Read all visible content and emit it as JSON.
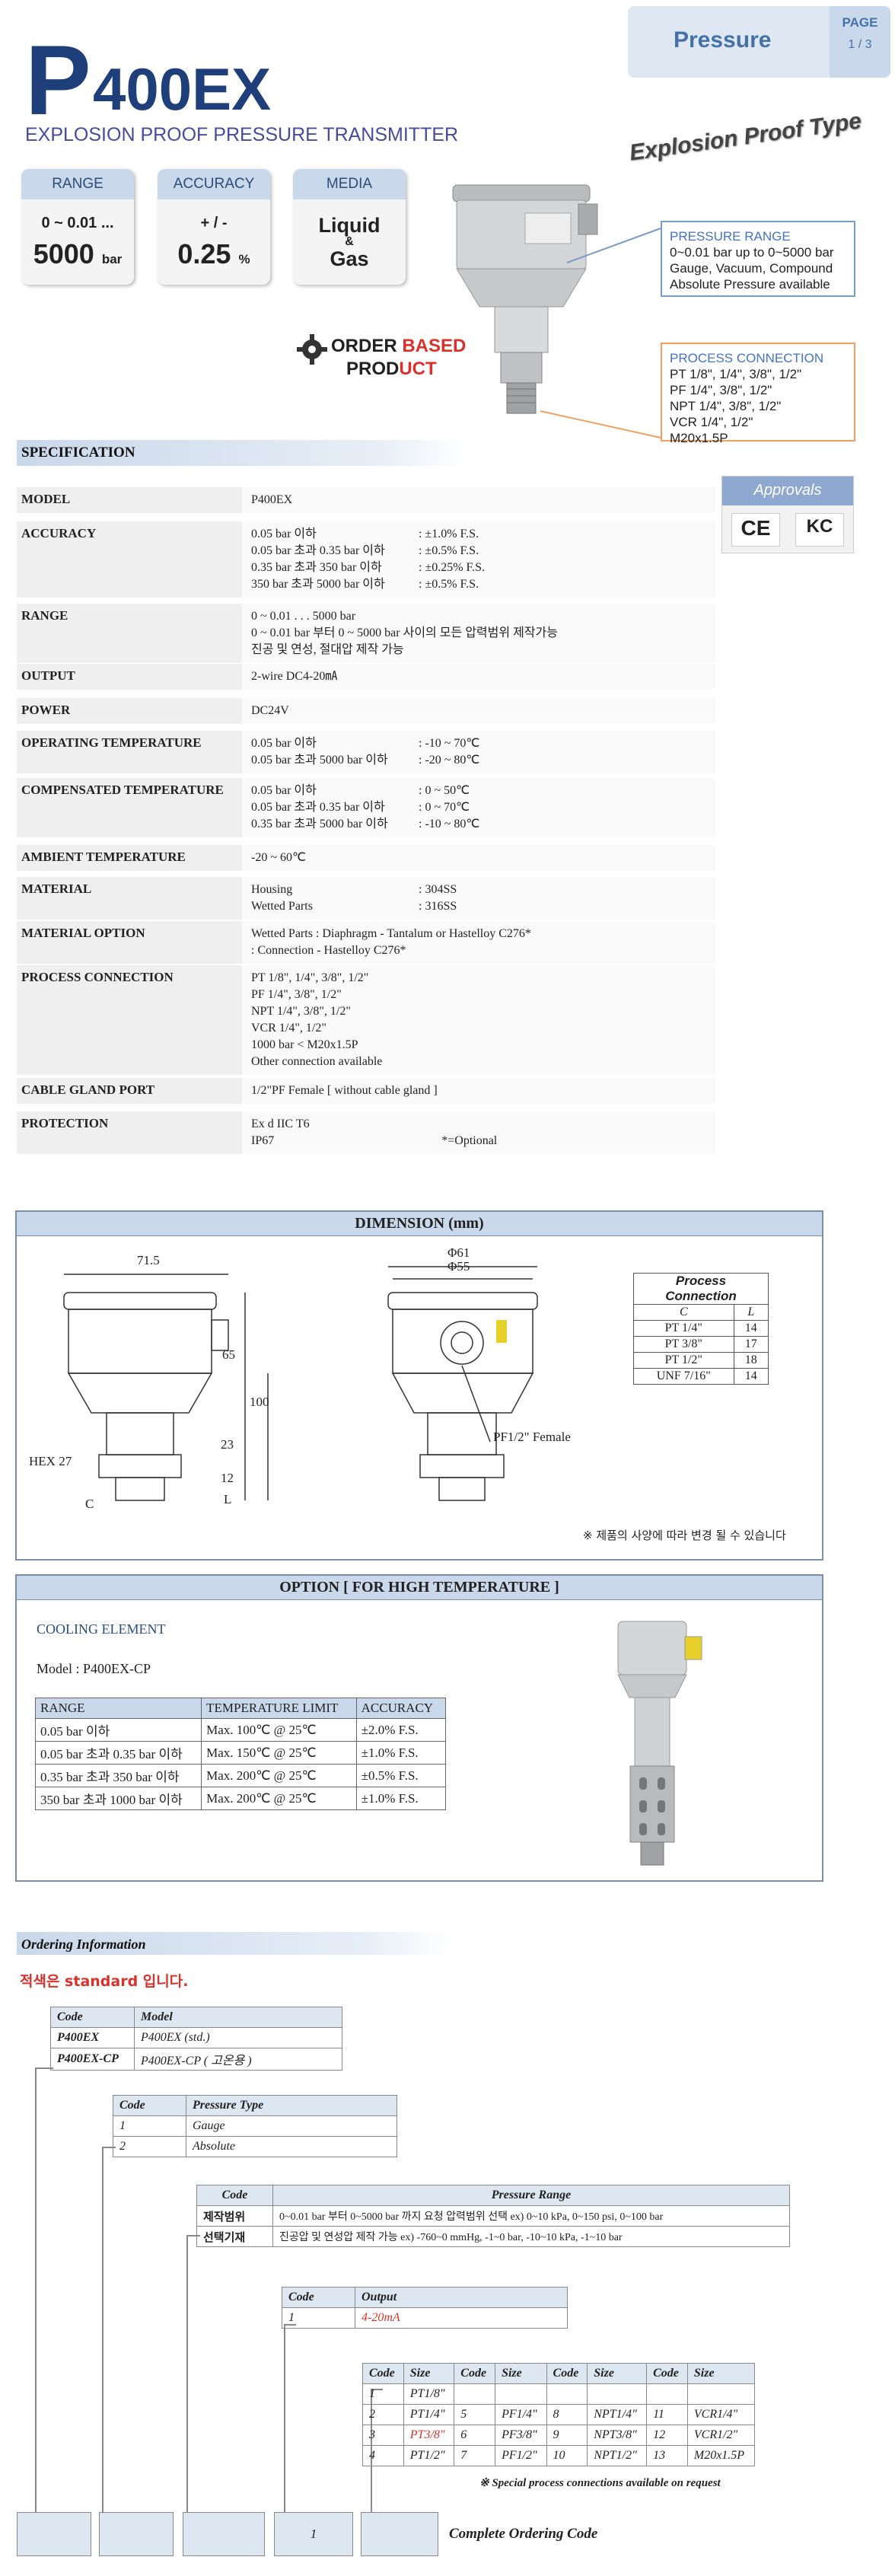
{
  "header": {
    "tab_label": "Pressure",
    "page_label": "PAGE",
    "page_number": "1 / 3",
    "model_big_p": "P",
    "model_rest": "400EX",
    "subtitle": "EXPLOSION PROOF PRESSURE TRANSMITTER",
    "explosion_proof_type": "Explosion Proof Type"
  },
  "badges": [
    {
      "head": "RANGE",
      "line1": "0 ~ 0.01 ...",
      "big": "5000",
      "unit": "bar"
    },
    {
      "head": "ACCURACY",
      "line1": "+ / -",
      "big": "0.25",
      "unit": "%"
    },
    {
      "head": "MEDIA",
      "line1": "Liquid",
      "amp": "&",
      "line2": "Gas"
    }
  ],
  "callouts": {
    "pressure_range": {
      "title": "PRESSURE RANGE",
      "lines": [
        "0~0.01 bar up to 0~5000 bar",
        "Gauge, Vacuum, Compound",
        "Absolute Pressure available"
      ]
    },
    "process_connection": {
      "title": "PROCESS CONNECTION",
      "lines": [
        "PT 1/8\", 1/4\", 3/8\", 1/2\"",
        "PF 1/4\", 3/8\", 1/2\"",
        "NPT 1/4\", 3/8\", 1/2\"",
        "VCR 1/4\", 1/2\"",
        "M20x1.5P"
      ]
    }
  },
  "order_based": {
    "line1a": "ORDER ",
    "line1b": "BASED",
    "line2a": "PROD",
    "line2b": "UCT"
  },
  "specification": {
    "title": "SPECIFICATION",
    "approvals_title": "Approvals",
    "approvals_marks": [
      "CE",
      "KC"
    ],
    "rows": [
      {
        "key": "MODEL",
        "lines": [
          [
            "P400EX",
            ""
          ]
        ]
      },
      {
        "key": "ACCURACY",
        "lines": [
          [
            "0.05 bar 이하",
            ": ±1.0% F.S."
          ],
          [
            "0.05 bar 초과 0.35 bar 이하",
            ": ±0.5% F.S."
          ],
          [
            "0.35 bar 초과 350 bar 이하",
            ": ±0.25% F.S."
          ],
          [
            "350 bar 초과 5000 bar 이하",
            ": ±0.5% F.S."
          ]
        ]
      },
      {
        "key": "RANGE",
        "lines": [
          [
            "0 ~ 0.01 . . . 5000 bar",
            ""
          ],
          [
            "0 ~ 0.01 bar 부터 0 ~ 5000 bar 사이의 모든 압력범위 제작가능",
            ""
          ],
          [
            "진공 및 연성, 절대압 제작 가능",
            ""
          ]
        ]
      },
      {
        "key": "OUTPUT",
        "lines": [
          [
            "2-wire DC4-20㎃",
            ""
          ]
        ]
      },
      {
        "key": "POWER",
        "lines": [
          [
            "DC24V",
            ""
          ]
        ]
      },
      {
        "key": "OPERATING TEMPERATURE",
        "lines": [
          [
            "0.05 bar 이하",
            ": -10 ~ 70℃"
          ],
          [
            "0.05 bar 초과 5000 bar 이하",
            ": -20 ~ 80℃"
          ]
        ]
      },
      {
        "key": "COMPENSATED TEMPERATURE",
        "lines": [
          [
            "0.05 bar 이하",
            ": 0 ~ 50℃"
          ],
          [
            "0.05 bar 초과 0.35 bar 이하",
            ": 0 ~ 70℃"
          ],
          [
            "0.35 bar 초과 5000 bar 이하",
            ": -10 ~ 80℃"
          ]
        ]
      },
      {
        "key": "AMBIENT TEMPERATURE",
        "lines": [
          [
            "-20 ~ 60℃",
            ""
          ]
        ]
      },
      {
        "key": "MATERIAL",
        "lines": [
          [
            "Housing",
            ": 304SS"
          ],
          [
            "Wetted Parts",
            ": 316SS"
          ]
        ]
      },
      {
        "key": "MATERIAL OPTION",
        "lines": [
          [
            "Wetted Parts  : Diaphragm - Tantalum or Hastelloy C276*",
            ""
          ],
          [
            "                        : Connection - Hastelloy C276*",
            ""
          ]
        ]
      },
      {
        "key": "PROCESS CONNECTION",
        "lines": [
          [
            "PT 1/8\", 1/4\", 3/8\", 1/2\"",
            ""
          ],
          [
            "PF 1/4\", 3/8\", 1/2\"",
            ""
          ],
          [
            "NPT 1/4\", 3/8\", 1/2\"",
            ""
          ],
          [
            "VCR 1/4\", 1/2\"",
            ""
          ],
          [
            "1000 bar < M20x1.5P",
            ""
          ],
          [
            "Other connection available",
            ""
          ]
        ]
      },
      {
        "key": "CABLE GLAND PORT",
        "lines": [
          [
            "1/2\"PF Female [ without cable gland ]",
            ""
          ]
        ]
      },
      {
        "key": "PROTECTION",
        "lines": [
          [
            "Ex d IIC T6",
            ""
          ],
          [
            "IP67",
            "*=Optional"
          ]
        ]
      }
    ]
  },
  "dimension": {
    "title": "DIMENSION (mm)",
    "labels": {
      "w": "71.5",
      "d1": "Φ61",
      "d2": "Φ55",
      "h65": "65",
      "h100": "100",
      "h23": "23",
      "h12": "12",
      "L": "L",
      "C": "C",
      "hex": "HEX 27",
      "pf": "PF1/2\" Female"
    },
    "note": "※ 제품의 사양에 따라 변경 될 수 있습니다",
    "pc_table": {
      "title": "Process Connection",
      "headers": [
        "C",
        "L"
      ],
      "rows": [
        [
          "PT 1/4\"",
          "14"
        ],
        [
          "PT 3/8\"",
          "17"
        ],
        [
          "PT 1/2\"",
          "18"
        ],
        [
          "UNF 7/16\"",
          "14"
        ]
      ]
    }
  },
  "option": {
    "title": "OPTION [ FOR HIGH TEMPERATURE ]",
    "cooling": "COOLING ELEMENT",
    "model": "Model : P400EX-CP",
    "headers": [
      "RANGE",
      "TEMPERATURE LIMIT",
      "ACCURACY"
    ],
    "rows": [
      [
        "0.05 bar 이하",
        "Max. 100℃ @ 25℃",
        "±2.0% F.S."
      ],
      [
        "0.05 bar 초과 0.35 bar 이하",
        "Max. 150℃ @ 25℃",
        "±1.0% F.S."
      ],
      [
        "0.35 bar 초과 350 bar 이하",
        "Max. 200℃ @ 25℃",
        "±0.5% F.S."
      ],
      [
        "350 bar 초과 1000 bar 이하",
        "Max. 200℃ @ 25℃",
        "±1.0% F.S."
      ]
    ]
  },
  "ordering": {
    "title": "Ordering Information",
    "standard_note": "적색은 standard 입니다.",
    "model_table": {
      "headers": [
        "Code",
        "Model"
      ],
      "rows": [
        [
          "P400EX",
          "P400EX (std.)"
        ],
        [
          "P400EX-CP",
          "P400EX-CP ( 고온용 )"
        ]
      ]
    },
    "ptype_table": {
      "headers": [
        "Code",
        "Pressure Type"
      ],
      "rows": [
        [
          "1",
          "Gauge"
        ],
        [
          "2",
          "Absolute"
        ]
      ]
    },
    "prange_table": {
      "headers": [
        "Code",
        "Pressure Range"
      ],
      "rows": [
        [
          "제작범위",
          "0~0.01 bar 부터 0~5000 bar 까지 요청 압력범위 선택 ex) 0~10 kPa, 0~150 psi, 0~100 bar"
        ],
        [
          "선택기재",
          "진공압 및 연성압 제작 가능 ex) -760~0 mmHg, -1~0 bar, -10~10 kPa, -1~10 bar"
        ]
      ]
    },
    "output_table": {
      "headers": [
        "Code",
        "Output"
      ],
      "rows": [
        [
          "1",
          "4-20mA"
        ]
      ]
    },
    "size_table": {
      "headers": [
        "Code",
        "Size",
        "Code",
        "Size",
        "Code",
        "Size",
        "Code",
        "Size"
      ],
      "rows": [
        [
          "1",
          "PT1/8\"",
          "",
          "",
          "",
          "",
          "",
          ""
        ],
        [
          "2",
          "PT1/4\"",
          "5",
          "PF1/4\"",
          "8",
          "NPT1/4\"",
          "11",
          "VCR1/4\""
        ],
        [
          "3",
          "PT3/8\"",
          "6",
          "PF3/8\"",
          "9",
          "NPT3/8\"",
          "12",
          "VCR1/2\""
        ],
        [
          "4",
          "PT1/2\"",
          "7",
          "PF1/2\"",
          "10",
          "NPT1/2\"",
          "13",
          "M20x1.5P"
        ]
      ]
    },
    "special_note": "※ Special process connections available on request",
    "code_box_value": "1",
    "complete_label": "Complete Ordering Code"
  }
}
